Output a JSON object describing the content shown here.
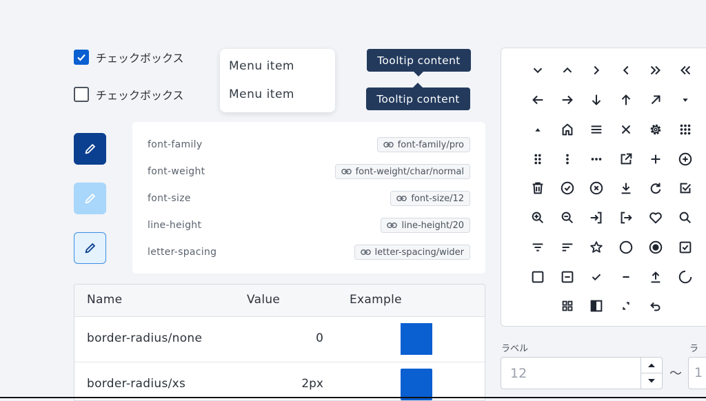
{
  "checkboxes": [
    {
      "label": "チェックボックス",
      "checked": true
    },
    {
      "label": "チェックボックス",
      "checked": false
    }
  ],
  "menu": {
    "items": [
      "Menu item",
      "Menu item"
    ]
  },
  "tooltips": [
    "Tooltip content",
    "Tooltip content"
  ],
  "edit_buttons": [
    {
      "variant": "filled-dark",
      "icon": "pencil-icon",
      "bg": "#0b3f8f",
      "fg": "#ffffff"
    },
    {
      "variant": "filled-light",
      "icon": "pencil-icon",
      "bg": "#a9d6fb",
      "fg": "#ffffff"
    },
    {
      "variant": "outlined",
      "icon": "pencil-icon",
      "bg": "#e3f2fd",
      "fg": "#0b3f8f"
    }
  ],
  "tokens": [
    {
      "label": "font-family",
      "value": "font-family/pro"
    },
    {
      "label": "font-weight",
      "value": "font-weight/char/normal"
    },
    {
      "label": "font-size",
      "value": "font-size/12"
    },
    {
      "label": "line-height",
      "value": "line-height/20"
    },
    {
      "label": "letter-spacing",
      "value": "letter-spacing/wider"
    }
  ],
  "table": {
    "headers": [
      "Name",
      "Value",
      "Example"
    ],
    "rows": [
      {
        "name": "border-radius/none",
        "value": "0"
      },
      {
        "name": "border-radius/xs",
        "value": "2px"
      }
    ]
  },
  "icons": [
    "chevron-down-icon",
    "chevron-up-icon",
    "chevron-right-icon",
    "chevron-left-icon",
    "double-chevron-right-icon",
    "double-chevron-left-icon",
    "arrow-left-icon",
    "arrow-right-icon",
    "arrow-down-icon",
    "arrow-up-icon",
    "arrow-up-right-icon",
    "caret-down-icon",
    "caret-up-icon",
    "home-icon",
    "menu-icon",
    "close-icon",
    "gear-icon",
    "grid-dots-icon",
    "drag-handle-icon",
    "more-vertical-icon",
    "more-horizontal-icon",
    "external-link-icon",
    "plus-icon",
    "plus-circle-icon",
    "trash-icon",
    "check-circle-icon",
    "close-circle-icon",
    "download-icon",
    "refresh-icon",
    "checkbox-checked-icon",
    "zoom-in-icon",
    "zoom-out-icon",
    "login-icon",
    "logout-icon",
    "heart-icon",
    "search-icon",
    "filter-icon",
    "sort-icon",
    "star-icon",
    "radio-unchecked-icon",
    "radio-checked-icon",
    "checkbox-square-checked-icon",
    "checkbox-empty-icon",
    "checkbox-indeterminate-icon",
    "check-icon",
    "minus-icon",
    "upload-icon",
    "spinner-icon",
    "grid-view-icon",
    "half-square-icon",
    "collapse-icon",
    "undo-icon"
  ],
  "number_field": {
    "label": "ラベル",
    "value": "12",
    "second_label": "ラベ",
    "second_value": "1",
    "separator": "〜"
  },
  "colors": {
    "primary": "#0a5fd1",
    "tooltip_bg": "#233a5d",
    "dark_button": "#0b3f8f"
  }
}
